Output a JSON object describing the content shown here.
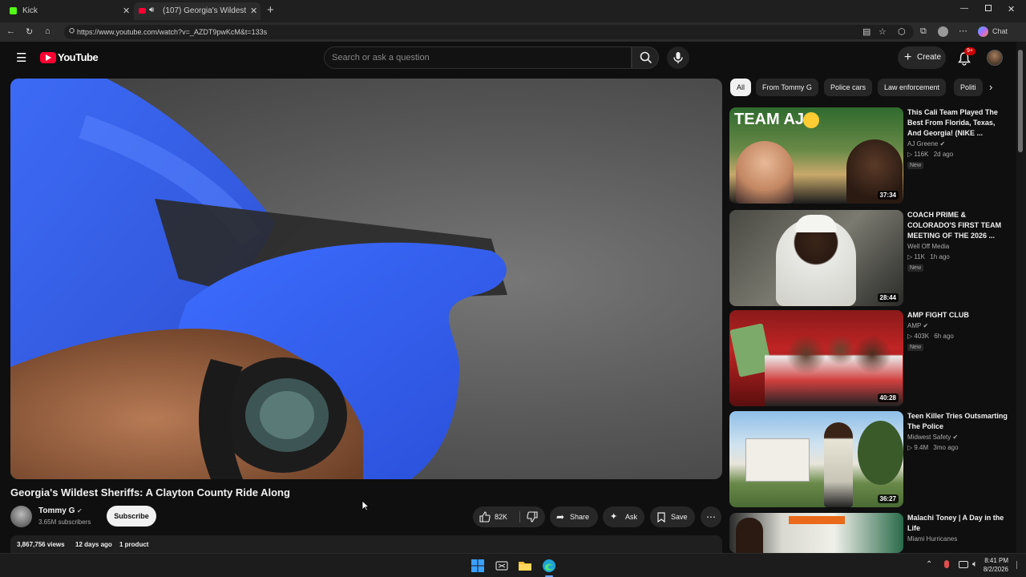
{
  "browser": {
    "tabs": [
      {
        "label": "Kick"
      },
      {
        "label": "(107) Georgia's Wildest Sheriffs"
      }
    ],
    "url": "https://www.youtube.com/watch?v=_AZDT9pwKcM&t=133s",
    "chat_label": "Chat"
  },
  "header": {
    "logo_text": "YouTube",
    "search_placeholder": "Search or ask a question",
    "create_label": "Create",
    "notifications_badge": "9+"
  },
  "video": {
    "title": "Georgia's Wildest Sheriffs: A Clayton County Ride Along",
    "channel": "Tommy G",
    "subscribers": "3.65M subscribers",
    "subscribe_label": "Subscribe",
    "likes": "82K",
    "share_label": "Share",
    "ask_label": "Ask",
    "save_label": "Save",
    "views": "3,867,756 views",
    "age": "12 days ago",
    "products": "1 product"
  },
  "chips": [
    "All",
    "From Tommy G",
    "Police cars",
    "Law enforcement",
    "Politi"
  ],
  "recommendations": [
    {
      "title": "This Cali Team Played The Best From Florida, Texas, And Georgia! (NIKE ...",
      "channel": "AJ Greene",
      "views": "116K",
      "age": "2d ago",
      "badge": "New",
      "duration": "37:34",
      "overlay_text": "TEAM AJ"
    },
    {
      "title": "COACH PRIME & COLORADO'S FIRST TEAM MEETING OF THE 2026 ...",
      "channel": "Well Off Media",
      "views": "11K",
      "age": "1h ago",
      "badge": "New",
      "duration": "28:44"
    },
    {
      "title": "AMP FIGHT CLUB",
      "channel": "AMP",
      "views": "403K",
      "age": "6h ago",
      "badge": "New",
      "duration": "40:28"
    },
    {
      "title": "Teen Killer Tries Outsmarting The Police",
      "channel": "Midwest Safety",
      "views": "9.4M",
      "age": "3mo ago",
      "duration": "36:27"
    },
    {
      "title": "Malachi Toney | A Day in the Life",
      "channel": "Miami Hurricanes"
    }
  ],
  "taskbar": {
    "time": "8:41 PM",
    "date": "8/2/2026"
  }
}
